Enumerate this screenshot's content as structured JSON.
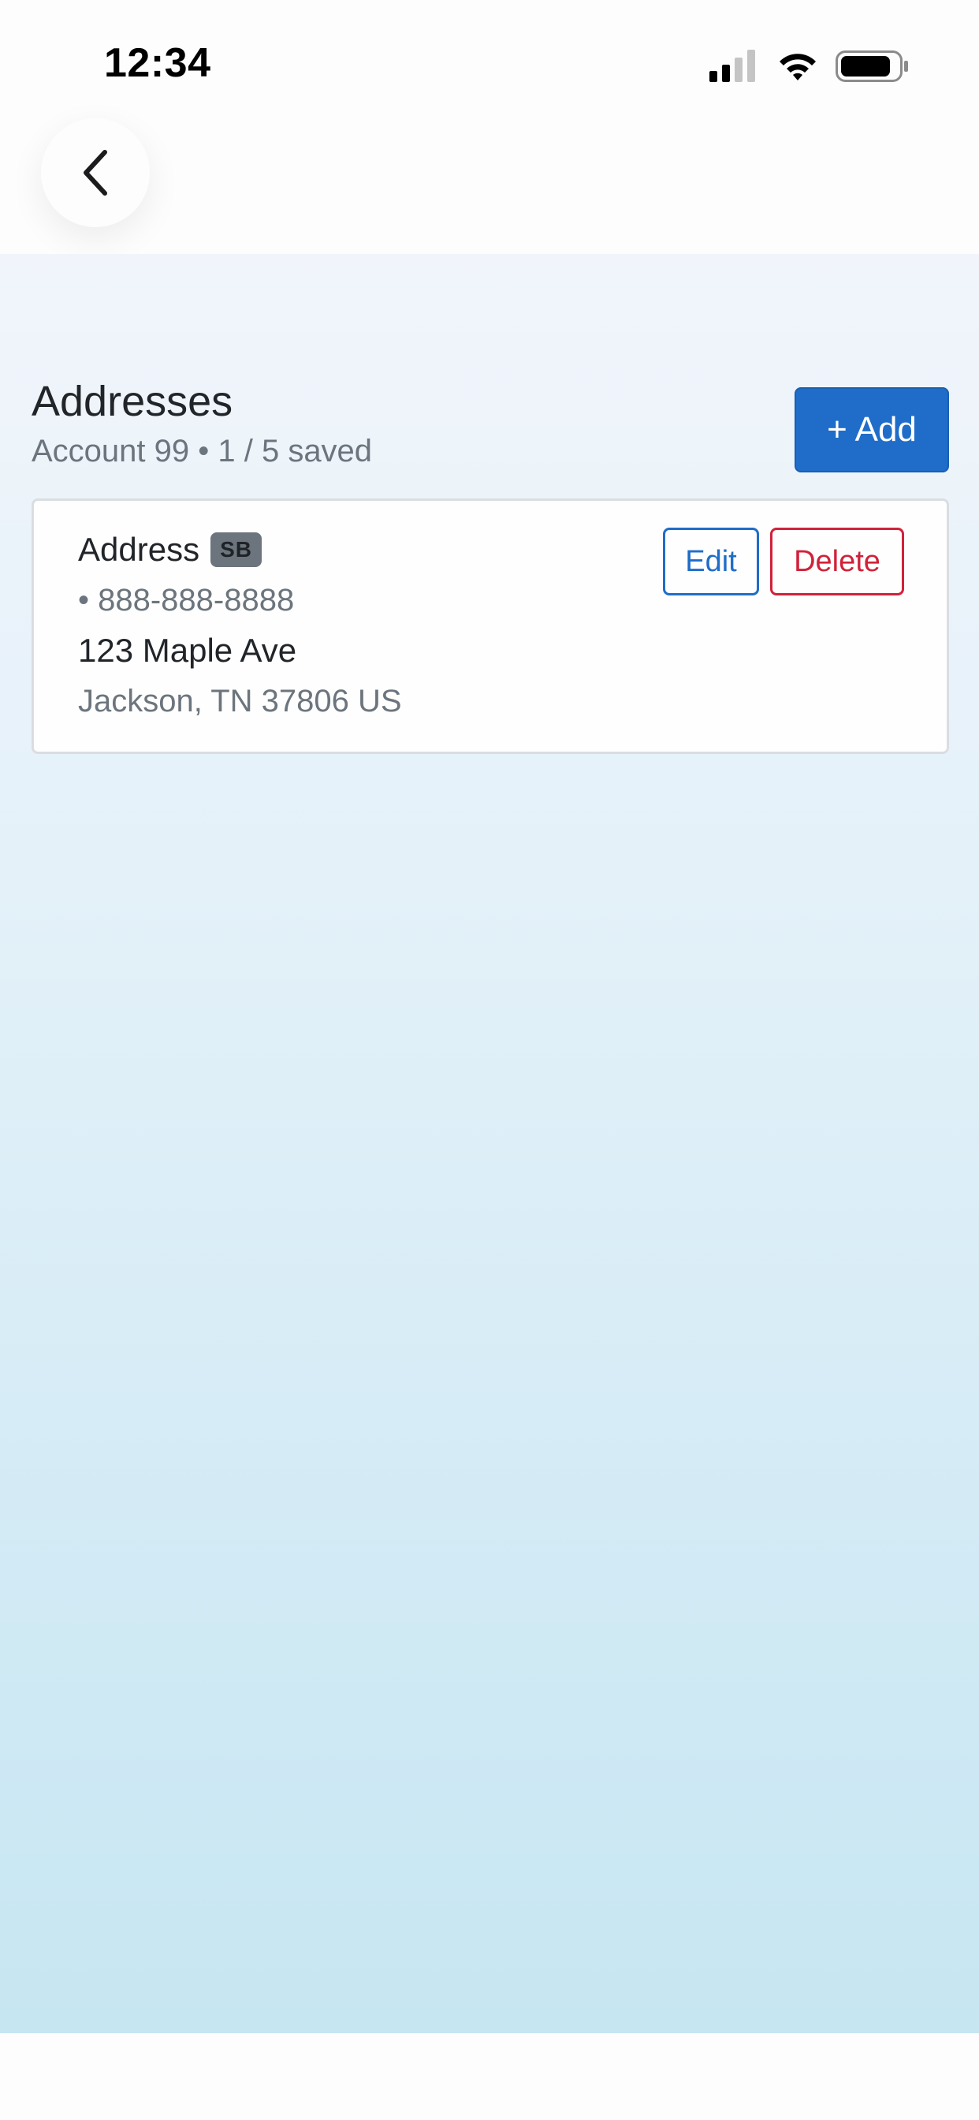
{
  "status_bar": {
    "time": "12:34",
    "icons": [
      "cellular-signal-icon",
      "wifi-icon",
      "battery-icon"
    ]
  },
  "header": {
    "back_icon": "chevron-left-icon"
  },
  "addresses": {
    "title": "Addresses",
    "subtitle": "Account 99 • 1 / 5 saved",
    "add_label": "+ Add",
    "items": [
      {
        "name": "Address",
        "badge": "SB",
        "phone": "• 888-888-8888",
        "street": "123 Maple Ave",
        "city_line": "Jackson, TN 37806 US",
        "edit_label": "Edit",
        "delete_label": "Delete"
      }
    ]
  },
  "colors": {
    "primary": "#1f6dc9",
    "danger": "#d0223a",
    "muted": "#6c757d",
    "text": "#212529",
    "badge_bg": "#6c757d"
  }
}
